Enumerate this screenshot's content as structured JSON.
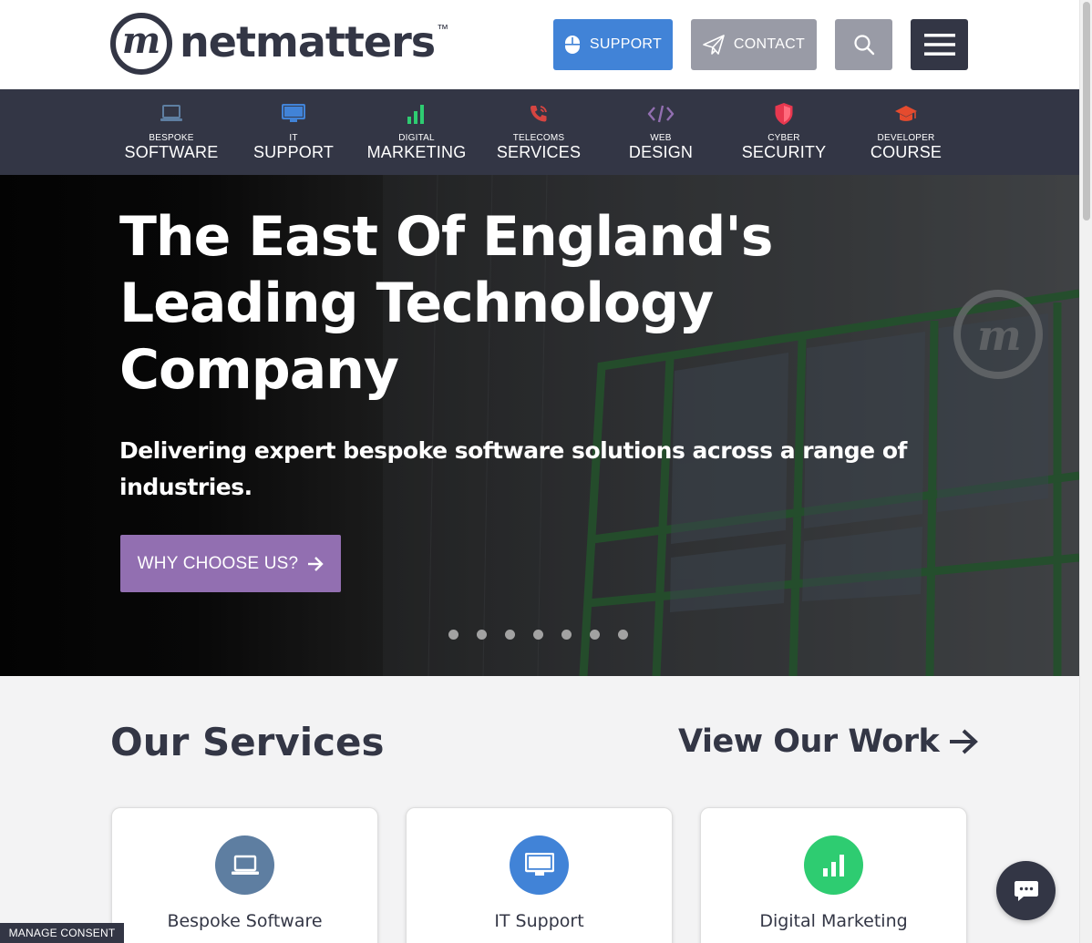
{
  "header": {
    "logo_letter": "m",
    "logo_text": "netmatters",
    "logo_tm": "™",
    "support_label": "SUPPORT",
    "contact_label": "CONTACT"
  },
  "nav": {
    "items": [
      {
        "small": "BESPOKE",
        "big": "SOFTWARE",
        "icon": "laptop-icon",
        "color": "#5e7ea1"
      },
      {
        "small": "IT",
        "big": "SUPPORT",
        "icon": "monitor-icon",
        "color": "#4183d7"
      },
      {
        "small": "DIGITAL",
        "big": "MARKETING",
        "icon": "bar-chart-icon",
        "color": "#2ecc71"
      },
      {
        "small": "TELECOMS",
        "big": "SERVICES",
        "icon": "phone-icon",
        "color": "#d64541"
      },
      {
        "small": "WEB",
        "big": "DESIGN",
        "icon": "code-icon",
        "color": "#926fb1"
      },
      {
        "small": "CYBER",
        "big": "SECURITY",
        "icon": "shield-icon",
        "color": "#e7384f"
      },
      {
        "small": "DEVELOPER",
        "big": "COURSE",
        "icon": "graduation-cap-icon",
        "color": "#e54b2e"
      }
    ]
  },
  "hero": {
    "title": "The East Of England's Leading Technology Company",
    "subtitle": "Delivering expert bespoke software solutions across a range of industries.",
    "cta_label": "WHY CHOOSE US?",
    "slide_count": 7
  },
  "services": {
    "title": "Our Services",
    "view_work_label": "View Our Work",
    "cards": [
      {
        "label": "Bespoke Software",
        "icon": "laptop-icon",
        "color": "#5e7ea1"
      },
      {
        "label": "IT Support",
        "icon": "monitor-icon",
        "color": "#4183d7"
      },
      {
        "label": "Digital Marketing",
        "icon": "bar-chart-icon",
        "color": "#2ecc71"
      }
    ]
  },
  "consent_label": "MANAGE CONSENT"
}
